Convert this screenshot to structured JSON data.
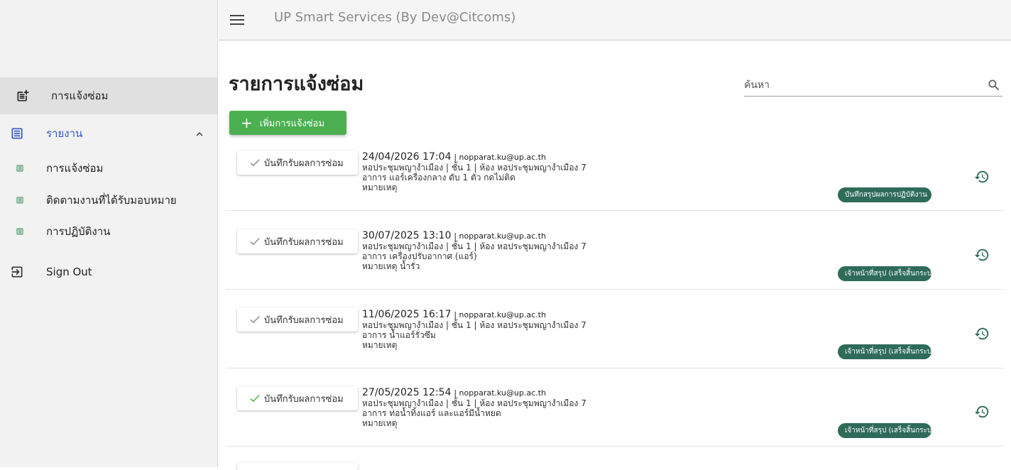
{
  "app": {
    "title": "UP Smart Services (By Dev@Citcoms)"
  },
  "sidebar": {
    "active_item": {
      "label": "การแจ้งซ่อม",
      "icon": "post-add-icon"
    },
    "group": {
      "label": "รายงาน",
      "icon": "list-alt-icon",
      "expanded": true
    },
    "sub_items": [
      {
        "label": "การแจ้งซ่อม",
        "icon": "list-alt-icon"
      },
      {
        "label": "ติดตามงานที่ได้รับมอบหมาย",
        "icon": "list-alt-icon"
      },
      {
        "label": "การปฏิบัติงาน",
        "icon": "list-alt-icon"
      }
    ],
    "sign_out": {
      "label": "Sign Out",
      "icon": "logout-icon"
    }
  },
  "main": {
    "title": "รายการแจ้งซ่อม",
    "search": {
      "placeholder": "ค้นหา",
      "value": ""
    },
    "add_button": "เพิ่มการแจ้งซ่อม",
    "colors": {
      "accent_green": "#4caf50",
      "badge": "#2e6b58",
      "check_grey": "#8e8e8e",
      "check_green": "#4caf50"
    },
    "records": [
      {
        "button": "บันทึกรับผลการซ่อม",
        "check_color": "grey",
        "datetime": "24/04/2026 17:04",
        "email": "| nopparat.ku@up.ac.th",
        "location": "หอประชุมพญางำเมือง | ชั้น 1 | ห้อง หอประชุมพญางำเมือง 7",
        "symptom": "อาการ แอร์เครื่องกลาง ดับ 1 ตัว กดไม่ติด",
        "note": "หมายเหตุ",
        "status": "บันทึกสรุปผลการปฏิบัติงาน"
      },
      {
        "button": "บันทึกรับผลการซ่อม",
        "check_color": "grey",
        "datetime": "30/07/2025 13:10",
        "email": "| nopparat.ku@up.ac.th",
        "location": "หอประชุมพญางำเมือง | ชั้น 1 | ห้อง หอประชุมพญางำเมือง 7",
        "symptom": "อาการ เครื่องปรับอากาศ (แอร์)",
        "note": "หมายเหตุ น้ำรั่ว",
        "status": "เจ้าหน้าที่สรุป (เสร็จสิ้นกระบวนการ)"
      },
      {
        "button": "บันทึกรับผลการซ่อม",
        "check_color": "grey",
        "datetime": "11/06/2025 16:17",
        "email": "| nopparat.ku@up.ac.th",
        "location": "หอประชุมพญางำเมือง | ชั้น 1 | ห้อง หอประชุมพญางำเมือง 7",
        "symptom": "อาการ น้ำแอร์รั่วซึม",
        "note": "หมายเหตุ",
        "status": "เจ้าหน้าที่สรุป (เสร็จสิ้นกระบวนการ)"
      },
      {
        "button": "บันทึกรับผลการซ่อม",
        "check_color": "green",
        "datetime": "27/05/2025 12:54",
        "email": "| nopparat.ku@up.ac.th",
        "location": "หอประชุมพญางำเมือง | ชั้น 1 | ห้อง หอประชุมพญางำเมือง 7",
        "symptom": "อาการ ท่อน้ำทิ้งแอร์ และแอร์มีน้ำหยด",
        "note": "หมายเหตุ",
        "status": "เจ้าหน้าที่สรุป (เสร็จสิ้นกระบวนการ)"
      }
    ]
  }
}
